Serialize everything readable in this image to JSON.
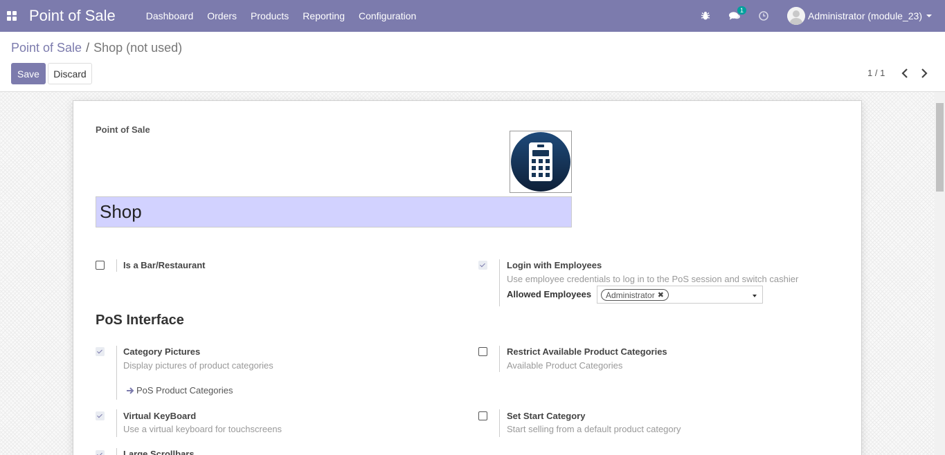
{
  "navbar": {
    "brand": "Point of Sale",
    "menu": [
      "Dashboard",
      "Orders",
      "Products",
      "Reporting",
      "Configuration"
    ],
    "messages_count": "1",
    "user": "Administrator (module_23)"
  },
  "breadcrumb": {
    "parent": "Point of Sale",
    "separator": "/",
    "current": "Shop (not used)"
  },
  "buttons": {
    "save": "Save",
    "discard": "Discard"
  },
  "pager": {
    "value": "1 / 1"
  },
  "form": {
    "section_label": "Point of Sale",
    "name": "Shop",
    "is_bar": {
      "label": "Is a Bar/Restaurant",
      "checked": false
    },
    "login_employees": {
      "label": "Login with Employees",
      "help": "Use employee credentials to log in to the PoS session and switch cashier",
      "checked": true
    },
    "allowed_employees": {
      "label": "Allowed Employees",
      "tags": [
        "Administrator"
      ]
    },
    "interface_title": "PoS Interface",
    "category_pictures": {
      "label": "Category Pictures",
      "help": "Display pictures of product categories",
      "checked": true,
      "link": "PoS Product Categories"
    },
    "restrict_categories": {
      "label": "Restrict Available Product Categories",
      "help": "Available Product Categories",
      "checked": false
    },
    "virtual_keyboard": {
      "label": "Virtual KeyBoard",
      "help": "Use a virtual keyboard for touchscreens",
      "checked": true
    },
    "start_category": {
      "label": "Set Start Category",
      "help": "Start selling from a default product category",
      "checked": false
    },
    "large_scrollbars": {
      "label": "Large Scrollbars",
      "checked": true
    }
  }
}
